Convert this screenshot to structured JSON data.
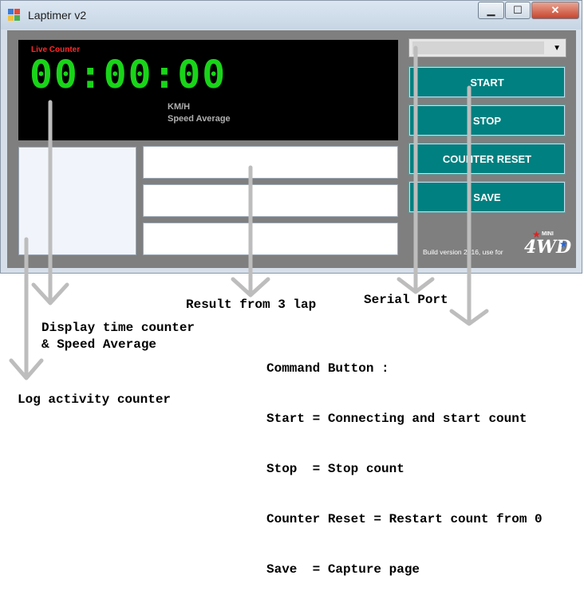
{
  "window": {
    "title": "Laptimer v2",
    "controls": {
      "minimize": "▁",
      "maximize": "☐",
      "close": "✕"
    }
  },
  "display": {
    "live_label": "Live Counter",
    "timer": "00:00:00",
    "unit": "KM/H",
    "speed_label": "Speed Average"
  },
  "serial_port": {
    "selected": ""
  },
  "buttons": {
    "start": "START",
    "stop": "STOP",
    "reset": "COUNTER RESET",
    "save": "SAVE"
  },
  "footer": {
    "build": "Build version 2016, use for",
    "logo_mini": "MINI",
    "logo_text": "4WD"
  },
  "annotations": {
    "result": "Result from 3 lap",
    "serial": "Serial Port",
    "display_line1": "Display time counter",
    "display_line2": "& Speed Average",
    "log": "Log activity counter",
    "commands": [
      "Command Button :",
      "Start = Connecting and start count",
      "Stop  = Stop count",
      "Counter Reset = Restart count from 0",
      "Save  = Capture page"
    ]
  },
  "colors": {
    "timer": "#19d419",
    "live_label": "#ff2a2a",
    "button": "#008080",
    "client_bg": "#7f7f7f"
  }
}
